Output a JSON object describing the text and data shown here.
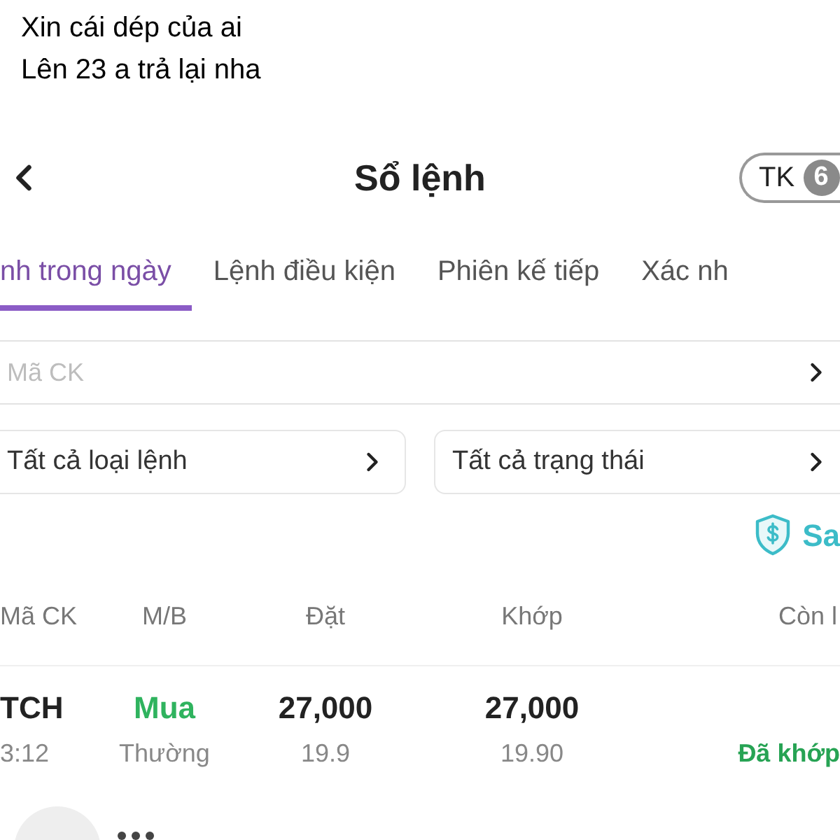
{
  "message": {
    "lines": [
      "Xin cái dép của ai",
      "Lên 23 a trả lại nha"
    ]
  },
  "header": {
    "title": "Sổ lệnh",
    "account": {
      "label": "TK",
      "badge": "6"
    }
  },
  "tabs": [
    {
      "label": "nh trong ngày",
      "selected": true
    },
    {
      "label": "Lệnh điều kiện",
      "selected": false
    },
    {
      "label": "Phiên kế tiếp",
      "selected": false
    },
    {
      "label": "Xác nh",
      "selected": false
    }
  ],
  "symbol_field": {
    "placeholder": "Mã CK"
  },
  "dropdowns": [
    {
      "value": "Tất cả loại lệnh"
    },
    {
      "value": "Tất cả trạng thái"
    }
  ],
  "link": {
    "label": "Sa"
  },
  "table": {
    "columns": [
      "Mã CK",
      "M/B",
      "Đặt",
      "Khớp",
      "Còn l"
    ],
    "rows": [
      {
        "symbol": "TCH",
        "time": "3:12",
        "side": {
          "label": "Mua",
          "kind": "buy"
        },
        "order_type": "Thường",
        "order": {
          "main": "27,000",
          "sub": "19.9"
        },
        "matched": {
          "main": "27,000",
          "sub": "19.90"
        },
        "status": {
          "label": "Đã khớp",
          "kind": "matched"
        }
      }
    ]
  }
}
